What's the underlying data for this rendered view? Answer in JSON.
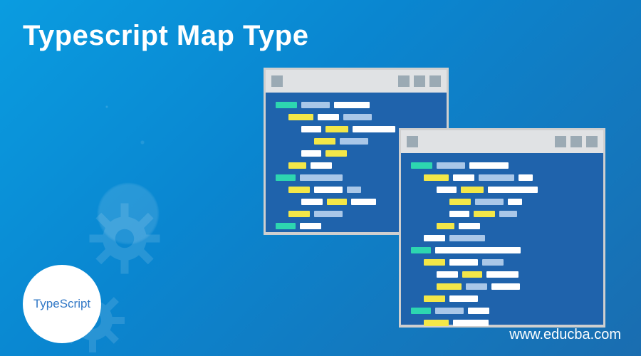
{
  "title": "Typescript Map Type",
  "website": "www.educba.com",
  "logo_text": "TypeScript",
  "colors": {
    "bg_gradient_start": "#0a9ce0",
    "bg_gradient_end": "#1a6db0",
    "window_bg": "#1f63ac",
    "window_border": "#cfcfcf",
    "titlebar_bg": "#e0e2e4",
    "titlebar_control": "#9baab4",
    "code_teal": "#2dd6b0",
    "code_yellow": "#f3e748",
    "code_white": "#ffffff",
    "code_light": "#a9c7e8",
    "logo_text_color": "#3178c6"
  },
  "icons": {
    "gear_1": "gear-icon",
    "gear_2": "gear-icon",
    "window_control": "window-control-icon"
  }
}
